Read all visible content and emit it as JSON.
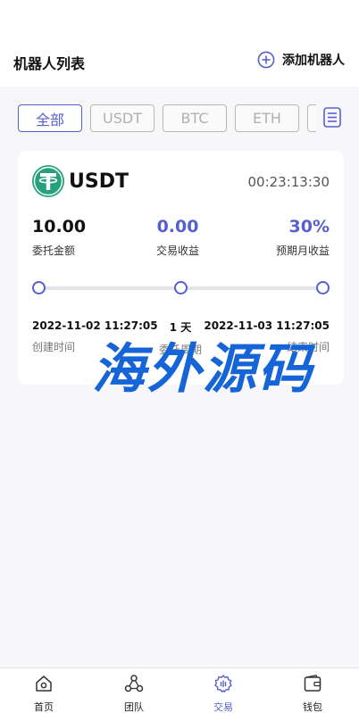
{
  "header": {
    "title": "机器人列表",
    "add_label": "添加机器人"
  },
  "tabs": [
    {
      "label": "全部",
      "active": true
    },
    {
      "label": "USDT",
      "active": false
    },
    {
      "label": "BTC",
      "active": false
    },
    {
      "label": "ETH",
      "active": false
    },
    {
      "label": "",
      "active": false
    }
  ],
  "robot_card": {
    "coin": "USDT",
    "coin_icon": "tether-icon",
    "countdown": "00:23:13:30",
    "stats": [
      {
        "value": "10.00",
        "label": "委托金额"
      },
      {
        "value": "0.00",
        "label": "交易收益"
      },
      {
        "value": "30%",
        "label": "预期月收益"
      }
    ],
    "timeline": [
      {
        "value": "2022-11-02 11:27:05",
        "label": "创建时间"
      },
      {
        "value": "1 天",
        "label": "委托周期"
      },
      {
        "value": "2022-11-03 11:27:05",
        "label": "结束时间"
      }
    ]
  },
  "watermark": "海外源码",
  "bottom_nav": [
    {
      "label": "首页",
      "icon": "home-icon",
      "active": false
    },
    {
      "label": "团队",
      "icon": "team-icon",
      "active": false
    },
    {
      "label": "交易",
      "icon": "trade-gear-icon",
      "active": true
    },
    {
      "label": "钱包",
      "icon": "wallet-icon",
      "active": false
    }
  ],
  "colors": {
    "accent": "#5660cc",
    "tether_green": "#26a17b",
    "watermark_blue": "#1565d8"
  }
}
